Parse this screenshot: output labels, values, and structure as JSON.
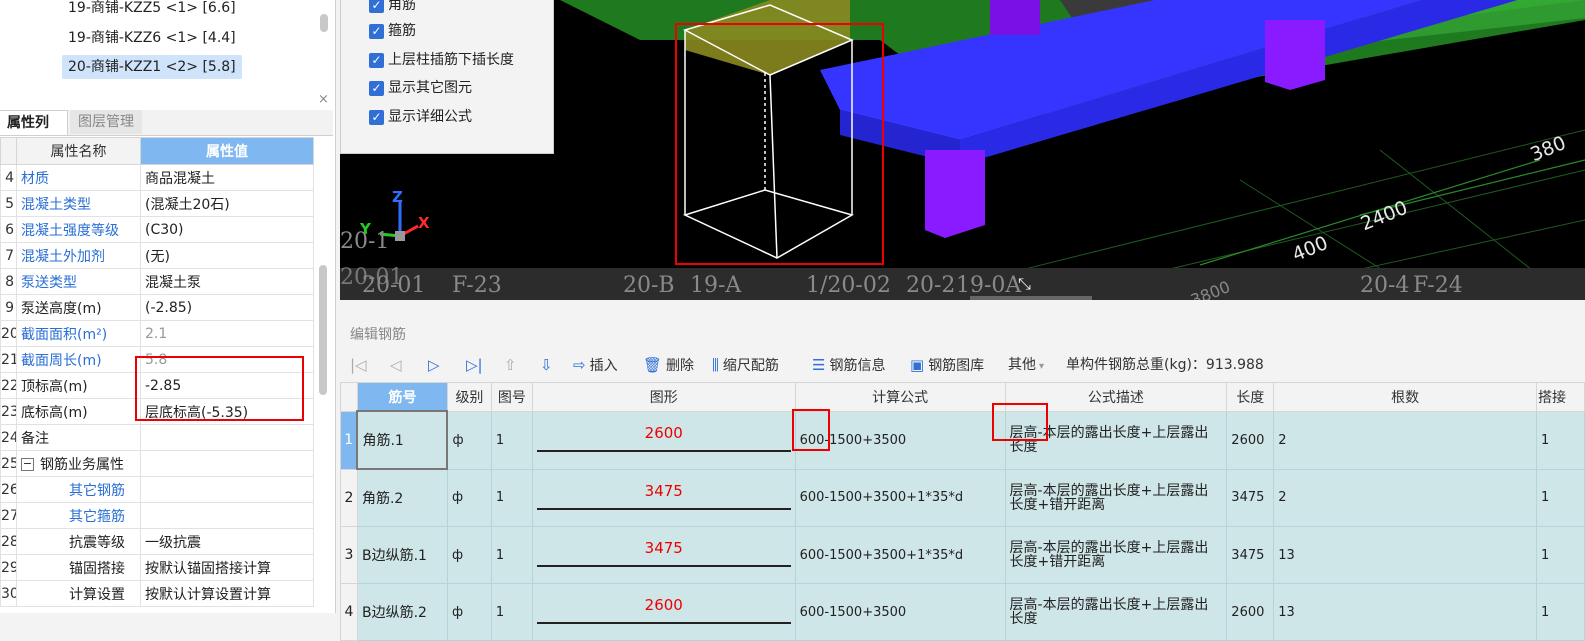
{
  "tree": {
    "items": [
      {
        "label": "19-商铺-KZZ5 <1> [6.6]",
        "selected": false
      },
      {
        "label": "19-商铺-KZZ6 <1> [4.4]",
        "selected": false
      },
      {
        "label": "20-商铺-KZZ1 <2> [5.8]",
        "selected": true
      }
    ]
  },
  "panel_close": "×",
  "tabs": {
    "attr_list": "属性列表",
    "layer_mgmt": "图层管理"
  },
  "attr_table": {
    "col_name": "属性名称",
    "col_value": "属性值",
    "rows": [
      {
        "num": "4",
        "name": "材质",
        "value": "商品混凝土"
      },
      {
        "num": "5",
        "name": "混凝土类型",
        "value": "(混凝土20石)"
      },
      {
        "num": "6",
        "name": "混凝土强度等级",
        "value": "(C30)"
      },
      {
        "num": "7",
        "name": "混凝土外加剂",
        "value": "(无)"
      },
      {
        "num": "8",
        "name": "泵送类型",
        "value": "混凝土泵"
      },
      {
        "num": "9",
        "name": "泵送高度(m)",
        "value": "(-2.85)"
      },
      {
        "num": "20",
        "name": "截面面积(m²)",
        "value": "2.1"
      },
      {
        "num": "21",
        "name": "截面周长(m)",
        "value": "5.8"
      },
      {
        "num": "22",
        "name": "顶标高(m)",
        "value": "-2.85"
      },
      {
        "num": "23",
        "name": "底标高(m)",
        "value": "层底标高(-5.35)"
      },
      {
        "num": "24",
        "name": "备注",
        "value": ""
      },
      {
        "num": "25",
        "name": "钢筋业务属性",
        "value": "",
        "expander": "−"
      },
      {
        "num": "26",
        "name": "其它钢筋",
        "value": ""
      },
      {
        "num": "27",
        "name": "其它箍筋",
        "value": ""
      },
      {
        "num": "28",
        "name": "抗震等级",
        "value": "一级抗震"
      },
      {
        "num": "29",
        "name": "锚固搭接",
        "value": "按默认锚固搭接计算"
      },
      {
        "num": "30",
        "name": "计算设置",
        "value": "按默认计算设置计算"
      }
    ]
  },
  "view3d": {
    "checkboxes": [
      {
        "label": "角筋",
        "checked": "✓"
      },
      {
        "label": "箍筋",
        "checked": "✓"
      },
      {
        "label": "上层柱插筋下插长度",
        "checked": "✓"
      },
      {
        "label": "显示其它图元",
        "checked": "✓"
      },
      {
        "label": "显示详细公式",
        "checked": "✓"
      }
    ],
    "axis_gizmo": {
      "z": "Z",
      "y": "Y",
      "x": "X"
    },
    "axis_labels": {
      "a": "20-1",
      "b": "20-01",
      "c": "20-01",
      "d": "F-23",
      "e": "20-B",
      "f": "19-A",
      "g": "1/20-02",
      "h": "20-2",
      "i": "19-0A",
      "j": "20-4",
      "k": "F-24"
    },
    "dimensions": {
      "d1": "2400",
      "d2": "400",
      "d3": "380",
      "d4": "3800"
    },
    "resize_icon": "⤡"
  },
  "edit": {
    "title": "编辑钢筋",
    "toolbar": {
      "first": "|◁",
      "prev": "◁",
      "next": "▷",
      "last": "▷|",
      "up": "⇧",
      "down": "⇩",
      "insert": "插入",
      "delete": "删除",
      "scale_rebar": "缩尺配筋",
      "rebar_info": "钢筋信息",
      "rebar_library": "钢筋图库",
      "other": "其他",
      "total_weight": "单构件钢筋总重(kg)：913.988"
    },
    "columns": {
      "name": "筋号",
      "grade": "级别",
      "fig": "图号",
      "shape": "图形",
      "formula": "计算公式",
      "desc": "公式描述",
      "length": "长度",
      "count": "根数",
      "lap": "搭接"
    },
    "rows": [
      {
        "num": "1",
        "name": "角筋.1",
        "grade": "ф",
        "fig": "1",
        "shape_val": "2600",
        "formula": "600-1500+3500",
        "desc": "层高-本层的露出长度+上层露出长度",
        "length": "2600",
        "count": "2",
        "lap": "1"
      },
      {
        "num": "2",
        "name": "角筋.2",
        "grade": "ф",
        "fig": "1",
        "shape_val": "3475",
        "formula": "600-1500+3500+1*35*d",
        "desc": "层高-本层的露出长度+上层露出长度+错开距离",
        "length": "3475",
        "count": "2",
        "lap": "1"
      },
      {
        "num": "3",
        "name": "B边纵筋.1",
        "grade": "ф",
        "fig": "1",
        "shape_val": "3475",
        "formula": "600-1500+3500+1*35*d",
        "desc": "层高-本层的露出长度+上层露出长度+错开距离",
        "length": "3475",
        "count": "13",
        "lap": "1"
      },
      {
        "num": "4",
        "name": "B边纵筋.2",
        "grade": "ф",
        "fig": "1",
        "shape_val": "2600",
        "formula": "600-1500+3500",
        "desc": "层高-本层的露出长度+上层露出长度",
        "length": "2600",
        "count": "13",
        "lap": "1"
      }
    ]
  },
  "colors": {
    "highlight_red": "#ee0000",
    "header_blue": "#7fb7f0",
    "row_teal": "#cfe6e8",
    "beam_blue": "#3a3aff",
    "column_purple": "#8a1aff"
  }
}
